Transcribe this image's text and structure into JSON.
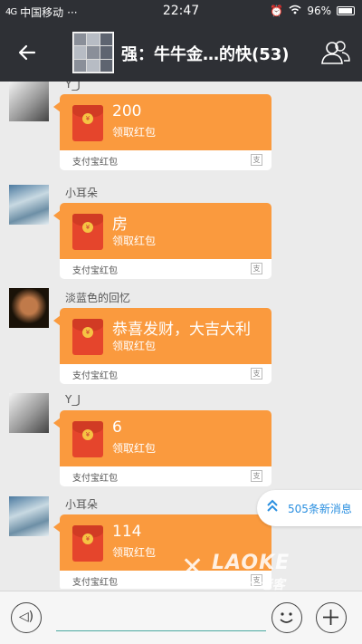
{
  "status_bar": {
    "carrier": "中国移动",
    "signal_text": "4G",
    "dots": "···",
    "time": "22:47",
    "battery": "96%"
  },
  "header": {
    "title": "强：牛牛金…的快(53)"
  },
  "messages": [
    {
      "sender": "Y_J",
      "amount": "200",
      "claim": "领取红包",
      "source": "支付宝红包",
      "avatar": "av-a"
    },
    {
      "sender": "小耳朵",
      "amount": "房",
      "claim": "领取红包",
      "source": "支付宝红包",
      "avatar": "av-b"
    },
    {
      "sender": "淡蓝色的回忆",
      "amount": "恭喜发财，大吉大利",
      "claim": "领取红包",
      "source": "支付宝红包",
      "avatar": "av-c"
    },
    {
      "sender": "Y_J",
      "amount": "6",
      "claim": "领取红包",
      "source": "支付宝红包",
      "avatar": "av-a"
    },
    {
      "sender": "小耳朵",
      "amount": "114",
      "claim": "领取红包",
      "source": "支付宝红包",
      "avatar": "av-b"
    }
  ],
  "new_messages": {
    "label": "505条新消息"
  },
  "watermark": {
    "brand": "LAOKE",
    "sub": ".com 老客"
  },
  "input": {
    "value": "",
    "placeholder": ""
  },
  "icons": {
    "back": "arrow-left-icon",
    "people": "group-members-icon",
    "voice": "voice-icon",
    "emoji": "smiley-icon",
    "plus": "plus-icon",
    "new_msg": "double-chevron-up-icon",
    "source": "alipay-icon"
  },
  "colors": {
    "nav_bg": "#2e3035",
    "bubble": "#fa9a3e",
    "envelope": "#e5452c",
    "chat_bg": "#ebebeb",
    "link": "#2a8fe0"
  }
}
